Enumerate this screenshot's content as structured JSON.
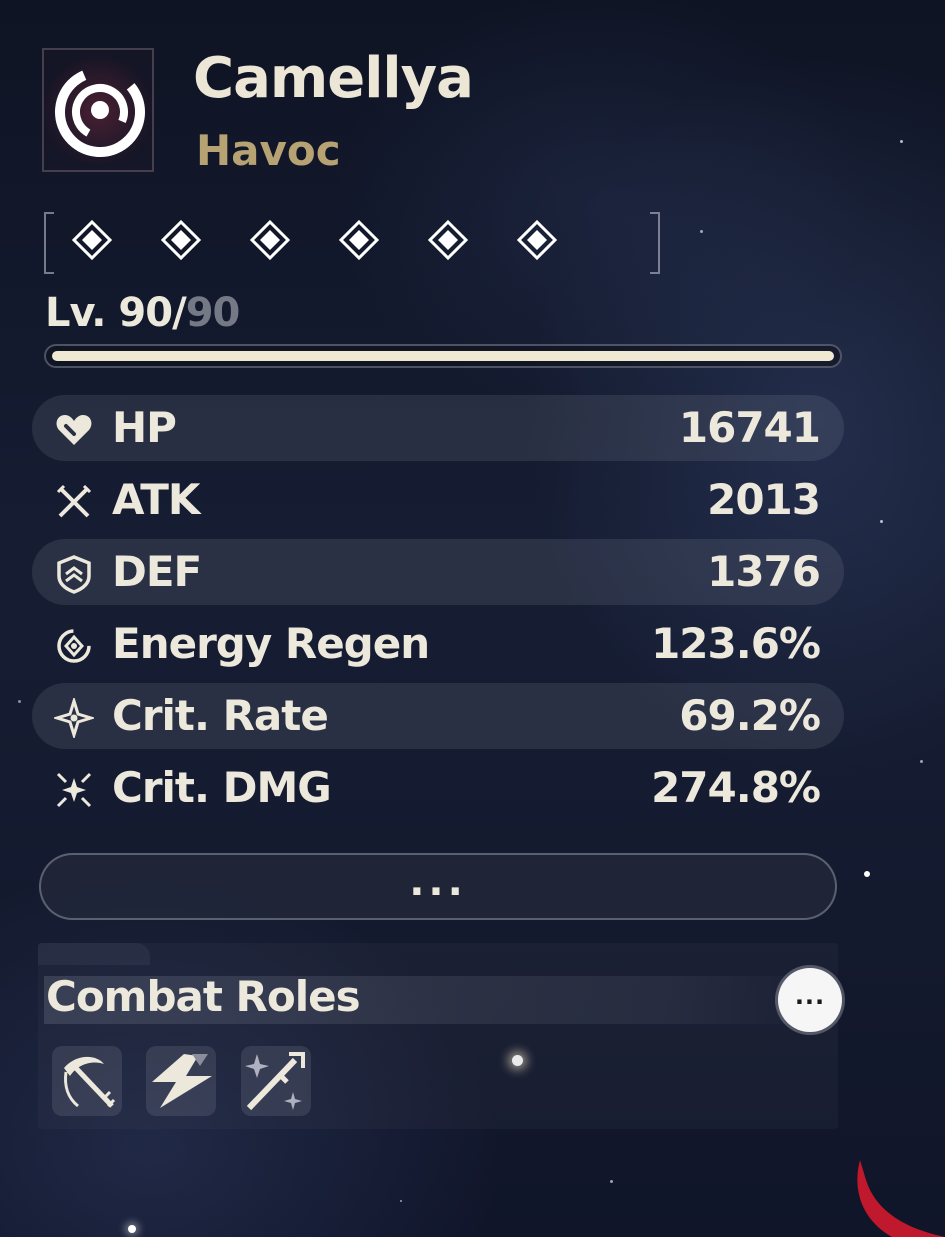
{
  "character": {
    "name": "Camellya",
    "element": "Havoc",
    "element_icon": "havoc-element-icon"
  },
  "resonance_chain": {
    "nodes_unlocked": 6,
    "nodes_total": 6,
    "node_icon": "diamond-icon"
  },
  "level": {
    "prefix": "Lv. ",
    "current": "90",
    "separator": "/",
    "max": "90",
    "progress_fraction": 1.0
  },
  "stats": [
    {
      "label": "HP",
      "value": "16741",
      "icon": "hp-heart-icon"
    },
    {
      "label": "ATK",
      "value": "2013",
      "icon": "atk-swords-icon"
    },
    {
      "label": "DEF",
      "value": "1376",
      "icon": "def-shield-icon"
    },
    {
      "label": "Energy Regen",
      "value": "123.6%",
      "icon": "energy-regen-icon"
    },
    {
      "label": "Crit. Rate",
      "value": "69.2%",
      "icon": "crit-rate-icon"
    },
    {
      "label": "Crit. DMG",
      "value": "274.8%",
      "icon": "crit-dmg-icon"
    }
  ],
  "more_button": {
    "label": "..."
  },
  "combat_roles": {
    "title": "Combat Roles",
    "info_button_label": "...",
    "roles": [
      {
        "icon": "scythe-sword-role-icon"
      },
      {
        "icon": "lightning-role-icon"
      },
      {
        "icon": "sword-sparkle-role-icon"
      }
    ]
  },
  "colors": {
    "name": "#ece6d6",
    "element_havoc": "#b7a273",
    "level_max": "#747985",
    "level_fill": "#efe9d4",
    "text": "#ece8dc"
  }
}
